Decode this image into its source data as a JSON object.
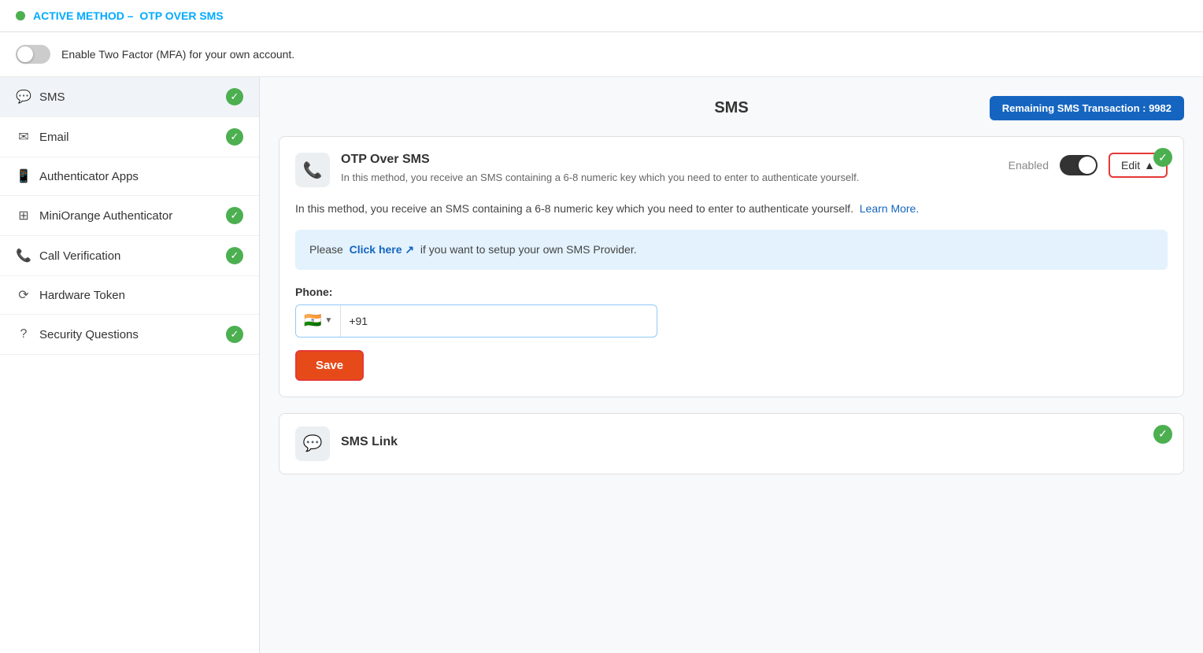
{
  "topBar": {
    "prefix": "ACTIVE METHOD –",
    "highlight": "OTP OVER SMS"
  },
  "mfa": {
    "label": "Enable Two Factor (MFA) for your own account.",
    "toggleState": "off"
  },
  "sidebar": {
    "items": [
      {
        "id": "sms",
        "icon": "💬",
        "label": "SMS",
        "checked": true,
        "active": true
      },
      {
        "id": "email",
        "icon": "✉",
        "label": "Email",
        "checked": true,
        "active": false
      },
      {
        "id": "authenticator",
        "icon": "📱",
        "label": "Authenticator Apps",
        "checked": false,
        "active": false
      },
      {
        "id": "miniorange",
        "icon": "⊞",
        "label": "MiniOrange Authenticator",
        "checked": true,
        "active": false
      },
      {
        "id": "call",
        "icon": "📞",
        "label": "Call Verification",
        "checked": true,
        "active": false
      },
      {
        "id": "hardware",
        "icon": "⟳",
        "label": "Hardware Token",
        "checked": false,
        "active": false
      },
      {
        "id": "security",
        "icon": "?",
        "label": "Security Questions",
        "checked": true,
        "active": false
      }
    ]
  },
  "rightPanel": {
    "title": "SMS",
    "badge": "Remaining SMS Transaction : 9982",
    "card1": {
      "methodIcon": "📞",
      "methodName": "OTP Over SMS",
      "methodDesc": "In this method, you receive an SMS containing a 6-8 numeric key which you need to enter to authenticate yourself.",
      "status": "Enabled",
      "editLabel": "Edit",
      "editCaret": "▲",
      "checked": true
    },
    "descText": "In this method, you receive an SMS containing a 6-8 numeric key which you need to enter to authenticate yourself.",
    "learnMore": "Learn More.",
    "infoBox": {
      "prefix": "Please",
      "linkText": "Click here ↗",
      "suffix": "if you want to setup your own SMS Provider."
    },
    "phoneLabel": "Phone:",
    "phonePlaceholder": "+91",
    "flagEmoji": "🇮🇳",
    "saveLabel": "Save",
    "card2": {
      "methodIcon": "💬",
      "methodName": "SMS Link",
      "checked": true
    }
  }
}
